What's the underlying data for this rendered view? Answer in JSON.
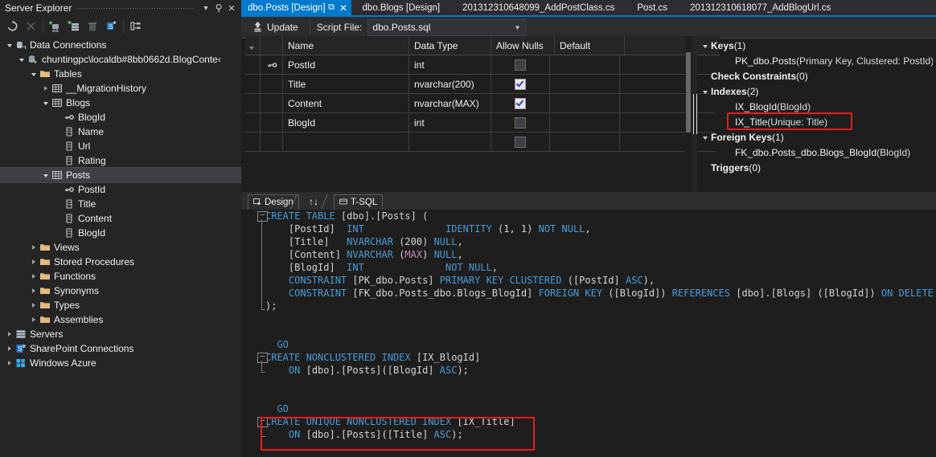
{
  "server_explorer": {
    "title": "Server Explorer",
    "title_buttons": [
      {
        "name": "dropdown",
        "glyph": "▾"
      },
      {
        "name": "pin",
        "glyph": "⚲"
      },
      {
        "name": "close",
        "glyph": "✕"
      }
    ],
    "toolbar": [
      {
        "name": "refresh-icon",
        "label": "Refresh"
      },
      {
        "name": "stop-icon",
        "label": "Stop"
      },
      {
        "name": "connect-to-database-icon",
        "label": "Connect to Database"
      },
      {
        "name": "connect-to-server-icon",
        "label": "Connect to Server"
      },
      {
        "name": "delete-icon",
        "label": "Delete"
      },
      {
        "name": "sharepoint-connection-icon",
        "label": "Add SharePoint Connection"
      },
      {
        "name": "object-hierarchy-icon",
        "label": "Object Hierarchy"
      }
    ],
    "tree": [
      {
        "label": "Data Connections",
        "depth": 0,
        "expander": "down",
        "icon": "data-connections-icon",
        "selected": false
      },
      {
        "label": "chuntingpc\\localdb#8bb0662d.BlogConte‹",
        "depth": 1,
        "expander": "down",
        "icon": "database-connection-icon",
        "selected": false
      },
      {
        "label": "Tables",
        "depth": 2,
        "expander": "down",
        "icon": "folder-icon",
        "selected": false
      },
      {
        "label": "__MigrationHistory",
        "depth": 3,
        "expander": "right",
        "icon": "table-icon",
        "selected": false
      },
      {
        "label": "Blogs",
        "depth": 3,
        "expander": "down",
        "icon": "table-icon",
        "selected": false
      },
      {
        "label": "BlogId",
        "depth": 4,
        "expander": "none",
        "icon": "key-column-icon",
        "selected": false
      },
      {
        "label": "Name",
        "depth": 4,
        "expander": "none",
        "icon": "column-icon",
        "selected": false
      },
      {
        "label": "Url",
        "depth": 4,
        "expander": "none",
        "icon": "column-icon",
        "selected": false
      },
      {
        "label": "Rating",
        "depth": 4,
        "expander": "none",
        "icon": "column-icon",
        "selected": false
      },
      {
        "label": "Posts",
        "depth": 3,
        "expander": "down",
        "icon": "table-icon",
        "selected": true
      },
      {
        "label": "PostId",
        "depth": 4,
        "expander": "none",
        "icon": "key-column-icon",
        "selected": false
      },
      {
        "label": "Title",
        "depth": 4,
        "expander": "none",
        "icon": "column-icon",
        "selected": false
      },
      {
        "label": "Content",
        "depth": 4,
        "expander": "none",
        "icon": "column-icon",
        "selected": false
      },
      {
        "label": "BlogId",
        "depth": 4,
        "expander": "none",
        "icon": "column-icon",
        "selected": false
      },
      {
        "label": "Views",
        "depth": 2,
        "expander": "right",
        "icon": "folder-icon",
        "selected": false
      },
      {
        "label": "Stored Procedures",
        "depth": 2,
        "expander": "right",
        "icon": "folder-icon",
        "selected": false
      },
      {
        "label": "Functions",
        "depth": 2,
        "expander": "right",
        "icon": "folder-icon",
        "selected": false
      },
      {
        "label": "Synonyms",
        "depth": 2,
        "expander": "right",
        "icon": "folder-icon",
        "selected": false
      },
      {
        "label": "Types",
        "depth": 2,
        "expander": "right",
        "icon": "folder-icon",
        "selected": false
      },
      {
        "label": "Assemblies",
        "depth": 2,
        "expander": "right",
        "icon": "folder-icon",
        "selected": false
      },
      {
        "label": "Servers",
        "depth": 0,
        "expander": "right",
        "icon": "servers-icon",
        "selected": false
      },
      {
        "label": "SharePoint Connections",
        "depth": 0,
        "expander": "right",
        "icon": "sharepoint-icon",
        "selected": false
      },
      {
        "label": "Windows Azure",
        "depth": 0,
        "expander": "right",
        "icon": "azure-icon",
        "selected": false
      }
    ]
  },
  "tabs": [
    {
      "label": "dbo.Posts [Design]",
      "active": true,
      "pin": "⧉",
      "close": "✕"
    },
    {
      "label": "dbo.Blogs [Design]",
      "active": false
    },
    {
      "label": "201312310648099_AddPostClass.cs",
      "active": false
    },
    {
      "label": "Post.cs",
      "active": false
    },
    {
      "label": "201312310618077_AddBlogUrl.cs",
      "active": false
    }
  ],
  "designer_toolbar": {
    "update_label": "Update",
    "update_icon": "update-arrow-icon",
    "script_file_label": "Script File:",
    "script_file_value": "dbo.Posts.sql",
    "dropdown_glyph": "▾"
  },
  "column_grid": {
    "headers": [
      "Name",
      "Data Type",
      "Allow Nulls",
      "Default"
    ],
    "rows": [
      {
        "key": true,
        "name": "PostId",
        "type": "int",
        "allow_nulls": false,
        "default": ""
      },
      {
        "key": false,
        "name": "Title",
        "type": "nvarchar(200)",
        "allow_nulls": true,
        "default": ""
      },
      {
        "key": false,
        "name": "Content",
        "type": "nvarchar(MAX)",
        "allow_nulls": true,
        "default": ""
      },
      {
        "key": false,
        "name": "BlogId",
        "type": "int",
        "allow_nulls": false,
        "default": ""
      },
      {
        "key": false,
        "name": "",
        "type": "",
        "allow_nulls": false,
        "default": ""
      }
    ]
  },
  "properties_panel": {
    "groups": [
      {
        "title": "Keys",
        "count": "(1)",
        "expander": "down",
        "items": [
          {
            "name": "PK_dbo.Posts",
            "detail": "(Primary Key, Clustered: PostId)",
            "highlight": false
          }
        ]
      },
      {
        "title": "Check Constraints",
        "count": "(0)",
        "expander": "none",
        "items": []
      },
      {
        "title": "Indexes",
        "count": "(2)",
        "expander": "down",
        "items": [
          {
            "name": "IX_BlogId",
            "detail": "(BlogId)",
            "highlight": false
          },
          {
            "name": "IX_Title",
            "detail": "(Unique: Title)",
            "highlight": true
          }
        ]
      },
      {
        "title": "Foreign Keys",
        "count": "(1)",
        "expander": "down",
        "items": [
          {
            "name": "FK_dbo.Posts_dbo.Blogs_BlogId",
            "detail": "(BlogId)",
            "highlight": false
          }
        ]
      },
      {
        "title": "Triggers",
        "count": "(0)",
        "expander": "none",
        "items": []
      }
    ]
  },
  "view_tabs": [
    {
      "label": "Design",
      "icon": "design-view-icon",
      "active": false
    },
    {
      "label": "↑↓",
      "icon": "sync-arrows-icon",
      "active": false
    },
    {
      "label": "T-SQL",
      "icon": "tsql-view-icon",
      "active": true
    }
  ],
  "code": {
    "lines": [
      {
        "fold": "minus",
        "parts": [
          {
            "t": "CREATE TABLE ",
            "c": "kw"
          },
          {
            "t": "[dbo].[Posts] (",
            "c": "id"
          }
        ]
      },
      {
        "parts": [
          {
            "t": "    [PostId]  ",
            "c": "id"
          },
          {
            "t": "INT",
            "c": "kw"
          },
          {
            "t": "              ",
            "c": "id"
          },
          {
            "t": "IDENTITY ",
            "c": "kw"
          },
          {
            "t": "(1, 1) ",
            "c": "id"
          },
          {
            "t": "NOT NULL",
            "c": "kw"
          },
          {
            "t": ",",
            "c": "id"
          }
        ]
      },
      {
        "parts": [
          {
            "t": "    [Title]   ",
            "c": "id"
          },
          {
            "t": "NVARCHAR ",
            "c": "kw"
          },
          {
            "t": "(200) ",
            "c": "id"
          },
          {
            "t": "NULL",
            "c": "kw"
          },
          {
            "t": ",",
            "c": "id"
          }
        ]
      },
      {
        "parts": [
          {
            "t": "    [Content] ",
            "c": "id"
          },
          {
            "t": "NVARCHAR ",
            "c": "kw"
          },
          {
            "t": "(",
            "c": "id"
          },
          {
            "t": "MAX",
            "c": "fn"
          },
          {
            "t": ") ",
            "c": "id"
          },
          {
            "t": "NULL",
            "c": "kw"
          },
          {
            "t": ",",
            "c": "id"
          }
        ]
      },
      {
        "parts": [
          {
            "t": "    [BlogId]  ",
            "c": "id"
          },
          {
            "t": "INT",
            "c": "kw"
          },
          {
            "t": "              ",
            "c": "id"
          },
          {
            "t": "NOT NULL",
            "c": "kw"
          },
          {
            "t": ",",
            "c": "id"
          }
        ]
      },
      {
        "parts": [
          {
            "t": "    ",
            "c": "id"
          },
          {
            "t": "CONSTRAINT ",
            "c": "kw"
          },
          {
            "t": "[PK_dbo.Posts] ",
            "c": "id"
          },
          {
            "t": "PRIMARY KEY CLUSTERED ",
            "c": "kw"
          },
          {
            "t": "([PostId] ",
            "c": "id"
          },
          {
            "t": "ASC",
            "c": "kw"
          },
          {
            "t": "),",
            "c": "id"
          }
        ]
      },
      {
        "parts": [
          {
            "t": "    ",
            "c": "id"
          },
          {
            "t": "CONSTRAINT ",
            "c": "kw"
          },
          {
            "t": "[FK_dbo.Posts_dbo.Blogs_BlogId] ",
            "c": "id"
          },
          {
            "t": "FOREIGN KEY ",
            "c": "kw"
          },
          {
            "t": "([BlogId]) ",
            "c": "id"
          },
          {
            "t": "REFERENCES ",
            "c": "kw"
          },
          {
            "t": "[dbo].[Blogs] ([BlogId]) ",
            "c": "id"
          },
          {
            "t": "ON DELETE C",
            "c": "kw"
          }
        ]
      },
      {
        "fold": "end",
        "parts": [
          {
            "t": ");",
            "c": "id"
          }
        ]
      },
      {
        "parts": []
      },
      {
        "parts": []
      },
      {
        "parts": [
          {
            "t": "  ",
            "c": "id"
          },
          {
            "t": "GO",
            "c": "kw"
          }
        ]
      },
      {
        "fold": "minus",
        "parts": [
          {
            "t": "CREATE NONCLUSTERED INDEX ",
            "c": "kw"
          },
          {
            "t": "[IX_BlogId]",
            "c": "id"
          }
        ]
      },
      {
        "fold": "end",
        "parts": [
          {
            "t": "    ",
            "c": "id"
          },
          {
            "t": "ON ",
            "c": "kw"
          },
          {
            "t": "[dbo].[Posts]([BlogId] ",
            "c": "id"
          },
          {
            "t": "ASC",
            "c": "kw"
          },
          {
            "t": ");",
            "c": "id"
          }
        ]
      },
      {
        "parts": []
      },
      {
        "parts": []
      },
      {
        "parts": [
          {
            "t": "  ",
            "c": "id"
          },
          {
            "t": "GO",
            "c": "kw"
          }
        ]
      },
      {
        "fold": "minus",
        "highlight": true,
        "parts": [
          {
            "t": "CREATE UNIQUE NONCLUSTERED INDEX ",
            "c": "kw"
          },
          {
            "t": "[IX_Title]",
            "c": "id"
          }
        ]
      },
      {
        "fold": "end",
        "highlight": true,
        "parts": [
          {
            "t": "    ",
            "c": "id"
          },
          {
            "t": "ON ",
            "c": "kw"
          },
          {
            "t": "[dbo].[Posts]([Title] ",
            "c": "id"
          },
          {
            "t": "ASC",
            "c": "kw"
          },
          {
            "t": ");",
            "c": "id"
          }
        ]
      }
    ]
  },
  "colors": {
    "accent": "#007acc",
    "highlight_red": "#e02020",
    "keyword_blue": "#4a9ad4",
    "function_purple": "#c586c0",
    "panel_bg": "#252526",
    "editor_bg": "#1e1e1e"
  }
}
